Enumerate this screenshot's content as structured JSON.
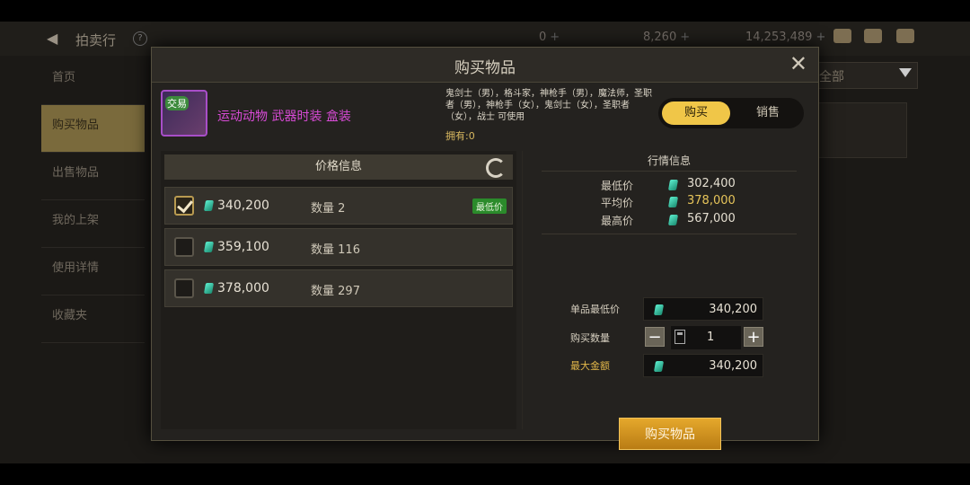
{
  "topbar": {
    "back_arrow": "◀",
    "title": "拍卖行",
    "help": "?",
    "currency1": "0",
    "currency2": "8,260",
    "currency3": "14,253,489",
    "plus": "+"
  },
  "sidebar": {
    "items": [
      {
        "label": "首页"
      },
      {
        "label": "购买物品"
      },
      {
        "label": "出售物品"
      },
      {
        "label": "我的上架"
      },
      {
        "label": "使用详情"
      },
      {
        "label": "收藏夹"
      }
    ],
    "active_index": 1
  },
  "bg_filter": {
    "label": "全部"
  },
  "modal": {
    "title": "购买物品",
    "close": "✕",
    "item": {
      "badge": "交易",
      "name": "运动动物 武器时装 盒装",
      "classes": "鬼剑士（男），格斗家，神枪手（男），魔法师，圣职者（男），神枪手（女），鬼剑士（女），圣职者（女），战士 可使用",
      "owned": "拥有:0"
    },
    "toggle": {
      "buy": "购买",
      "sell": "销售"
    },
    "price_info": {
      "title": "价格信息",
      "qty_label": "数量",
      "lowest_tag": "最低价",
      "rows": [
        {
          "price": "340,200",
          "qty": "2",
          "checked": true,
          "lowest": true
        },
        {
          "price": "359,100",
          "qty": "116",
          "checked": false,
          "lowest": false
        },
        {
          "price": "378,000",
          "qty": "297",
          "checked": false,
          "lowest": false
        }
      ]
    },
    "market": {
      "title": "行情信息",
      "min_label": "最低价",
      "min": "302,400",
      "avg_label": "平均价",
      "avg": "378,000",
      "max_label": "最高价",
      "max": "567,000"
    },
    "form": {
      "unit_min_label": "单品最低价",
      "unit_min": "340,200",
      "qty_label": "购买数量",
      "qty": "1",
      "minus": "−",
      "plus": "+",
      "max_total_label": "最大金额",
      "max_total": "340,200"
    },
    "buy_button": "购买物品"
  },
  "colors": {
    "accent": "#f0c648",
    "item_name": "#d84bd6",
    "lowest_tag": "#2b8b2b",
    "buy_button": "#d99a22"
  }
}
